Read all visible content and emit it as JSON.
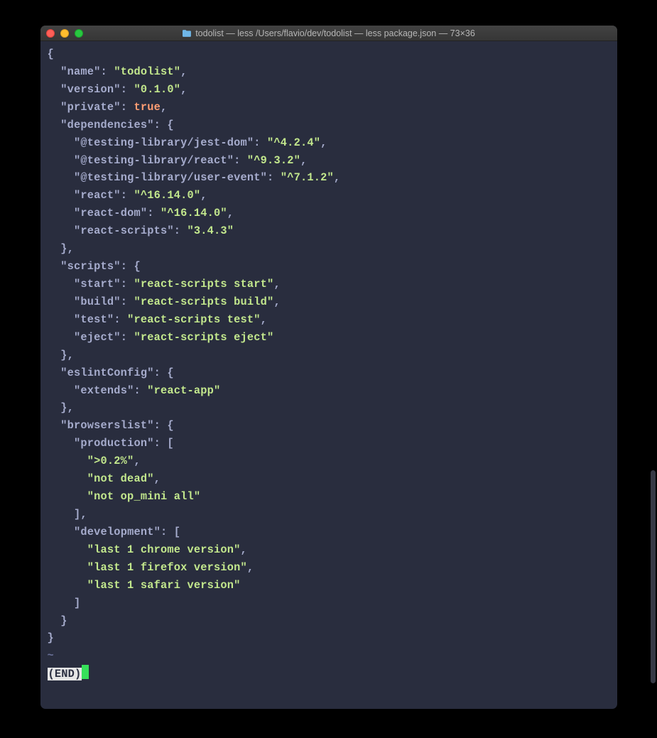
{
  "titlebar": {
    "title": "todolist — less /Users/flavio/dev/todolist — less package.json — 73×36"
  },
  "content": {
    "lines": [
      {
        "indent": 0,
        "segments": [
          {
            "t": "{",
            "c": "punc"
          }
        ]
      },
      {
        "indent": 1,
        "segments": [
          {
            "t": "\"name\"",
            "c": "key"
          },
          {
            "t": ": ",
            "c": "punc"
          },
          {
            "t": "\"todolist\"",
            "c": "str"
          },
          {
            "t": ",",
            "c": "punc"
          }
        ]
      },
      {
        "indent": 1,
        "segments": [
          {
            "t": "\"version\"",
            "c": "key"
          },
          {
            "t": ": ",
            "c": "punc"
          },
          {
            "t": "\"0.1.0\"",
            "c": "str"
          },
          {
            "t": ",",
            "c": "punc"
          }
        ]
      },
      {
        "indent": 1,
        "segments": [
          {
            "t": "\"private\"",
            "c": "key"
          },
          {
            "t": ": ",
            "c": "punc"
          },
          {
            "t": "true",
            "c": "bool"
          },
          {
            "t": ",",
            "c": "punc"
          }
        ]
      },
      {
        "indent": 1,
        "segments": [
          {
            "t": "\"dependencies\"",
            "c": "key"
          },
          {
            "t": ": {",
            "c": "punc"
          }
        ]
      },
      {
        "indent": 2,
        "segments": [
          {
            "t": "\"@testing-library/jest-dom\"",
            "c": "key"
          },
          {
            "t": ": ",
            "c": "punc"
          },
          {
            "t": "\"^4.2.4\"",
            "c": "str"
          },
          {
            "t": ",",
            "c": "punc"
          }
        ]
      },
      {
        "indent": 2,
        "segments": [
          {
            "t": "\"@testing-library/react\"",
            "c": "key"
          },
          {
            "t": ": ",
            "c": "punc"
          },
          {
            "t": "\"^9.3.2\"",
            "c": "str"
          },
          {
            "t": ",",
            "c": "punc"
          }
        ]
      },
      {
        "indent": 2,
        "segments": [
          {
            "t": "\"@testing-library/user-event\"",
            "c": "key"
          },
          {
            "t": ": ",
            "c": "punc"
          },
          {
            "t": "\"^7.1.2\"",
            "c": "str"
          },
          {
            "t": ",",
            "c": "punc"
          }
        ]
      },
      {
        "indent": 2,
        "segments": [
          {
            "t": "\"react\"",
            "c": "key"
          },
          {
            "t": ": ",
            "c": "punc"
          },
          {
            "t": "\"^16.14.0\"",
            "c": "str"
          },
          {
            "t": ",",
            "c": "punc"
          }
        ]
      },
      {
        "indent": 2,
        "segments": [
          {
            "t": "\"react-dom\"",
            "c": "key"
          },
          {
            "t": ": ",
            "c": "punc"
          },
          {
            "t": "\"^16.14.0\"",
            "c": "str"
          },
          {
            "t": ",",
            "c": "punc"
          }
        ]
      },
      {
        "indent": 2,
        "segments": [
          {
            "t": "\"react-scripts\"",
            "c": "key"
          },
          {
            "t": ": ",
            "c": "punc"
          },
          {
            "t": "\"3.4.3\"",
            "c": "str"
          }
        ]
      },
      {
        "indent": 1,
        "segments": [
          {
            "t": "},",
            "c": "punc"
          }
        ]
      },
      {
        "indent": 1,
        "segments": [
          {
            "t": "\"scripts\"",
            "c": "key"
          },
          {
            "t": ": {",
            "c": "punc"
          }
        ]
      },
      {
        "indent": 2,
        "segments": [
          {
            "t": "\"start\"",
            "c": "key"
          },
          {
            "t": ": ",
            "c": "punc"
          },
          {
            "t": "\"react-scripts start\"",
            "c": "str"
          },
          {
            "t": ",",
            "c": "punc"
          }
        ]
      },
      {
        "indent": 2,
        "segments": [
          {
            "t": "\"build\"",
            "c": "key"
          },
          {
            "t": ": ",
            "c": "punc"
          },
          {
            "t": "\"react-scripts build\"",
            "c": "str"
          },
          {
            "t": ",",
            "c": "punc"
          }
        ]
      },
      {
        "indent": 2,
        "segments": [
          {
            "t": "\"test\"",
            "c": "key"
          },
          {
            "t": ": ",
            "c": "punc"
          },
          {
            "t": "\"react-scripts test\"",
            "c": "str"
          },
          {
            "t": ",",
            "c": "punc"
          }
        ]
      },
      {
        "indent": 2,
        "segments": [
          {
            "t": "\"eject\"",
            "c": "key"
          },
          {
            "t": ": ",
            "c": "punc"
          },
          {
            "t": "\"react-scripts eject\"",
            "c": "str"
          }
        ]
      },
      {
        "indent": 1,
        "segments": [
          {
            "t": "},",
            "c": "punc"
          }
        ]
      },
      {
        "indent": 1,
        "segments": [
          {
            "t": "\"eslintConfig\"",
            "c": "key"
          },
          {
            "t": ": {",
            "c": "punc"
          }
        ]
      },
      {
        "indent": 2,
        "segments": [
          {
            "t": "\"extends\"",
            "c": "key"
          },
          {
            "t": ": ",
            "c": "punc"
          },
          {
            "t": "\"react-app\"",
            "c": "str"
          }
        ]
      },
      {
        "indent": 1,
        "segments": [
          {
            "t": "},",
            "c": "punc"
          }
        ]
      },
      {
        "indent": 1,
        "segments": [
          {
            "t": "\"browserslist\"",
            "c": "key"
          },
          {
            "t": ": {",
            "c": "punc"
          }
        ]
      },
      {
        "indent": 2,
        "segments": [
          {
            "t": "\"production\"",
            "c": "key"
          },
          {
            "t": ": [",
            "c": "punc"
          }
        ]
      },
      {
        "indent": 3,
        "segments": [
          {
            "t": "\">0.2%\"",
            "c": "str"
          },
          {
            "t": ",",
            "c": "punc"
          }
        ]
      },
      {
        "indent": 3,
        "segments": [
          {
            "t": "\"not dead\"",
            "c": "str"
          },
          {
            "t": ",",
            "c": "punc"
          }
        ]
      },
      {
        "indent": 3,
        "segments": [
          {
            "t": "\"not op_mini all\"",
            "c": "str"
          }
        ]
      },
      {
        "indent": 2,
        "segments": [
          {
            "t": "],",
            "c": "punc"
          }
        ]
      },
      {
        "indent": 2,
        "segments": [
          {
            "t": "\"development\"",
            "c": "key"
          },
          {
            "t": ": [",
            "c": "punc"
          }
        ]
      },
      {
        "indent": 3,
        "segments": [
          {
            "t": "\"last 1 chrome version\"",
            "c": "str"
          },
          {
            "t": ",",
            "c": "punc"
          }
        ]
      },
      {
        "indent": 3,
        "segments": [
          {
            "t": "\"last 1 firefox version\"",
            "c": "str"
          },
          {
            "t": ",",
            "c": "punc"
          }
        ]
      },
      {
        "indent": 3,
        "segments": [
          {
            "t": "\"last 1 safari version\"",
            "c": "str"
          }
        ]
      },
      {
        "indent": 2,
        "segments": [
          {
            "t": "]",
            "c": "punc"
          }
        ]
      },
      {
        "indent": 1,
        "segments": [
          {
            "t": "}",
            "c": "punc"
          }
        ]
      },
      {
        "indent": 0,
        "segments": [
          {
            "t": "}",
            "c": "punc"
          }
        ]
      }
    ],
    "tilde": "~",
    "end_marker": "(END)"
  }
}
